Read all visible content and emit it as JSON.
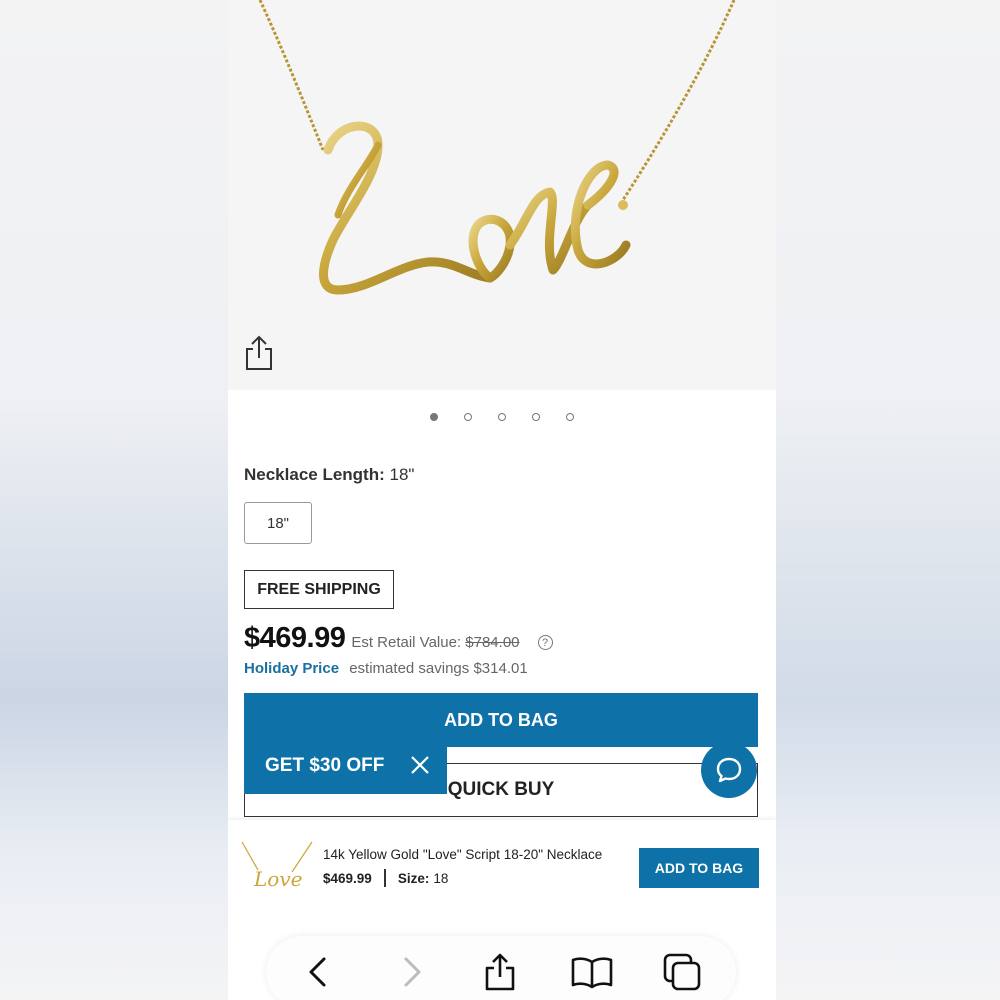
{
  "product_image": {
    "alt_icon": "love-script-necklace-image",
    "carousel": {
      "count": 5,
      "active_index": 0
    }
  },
  "options": {
    "length_label": "Necklace Length:",
    "length_value": "18\"",
    "chip_label": "18\""
  },
  "shipping_badge": "FREE SHIPPING",
  "pricing": {
    "price": "$469.99",
    "retail_label": "Est Retail Value:",
    "retail_value": "$784.00",
    "help_glyph": "?",
    "holiday_label": "Holiday Price",
    "savings_text": "estimated savings $314.01"
  },
  "actions": {
    "add_to_bag": "ADD TO BAG",
    "quick_buy": "QUICK BUY"
  },
  "promo": {
    "label": "GET $30 OFF"
  },
  "sticky": {
    "title": "14k Yellow Gold \"Love\" Script 18-20\" Necklace",
    "price": "$469.99",
    "size_label": "Size:",
    "size_value": "18",
    "add_to_bag": "ADD TO BAG"
  },
  "browser_toolbar": {
    "icons": [
      "back-icon",
      "forward-icon",
      "share-icon",
      "bookmarks-icon",
      "tabs-icon"
    ]
  },
  "colors": {
    "brand_blue": "#0e72a8",
    "gold": "#c9a73c"
  }
}
